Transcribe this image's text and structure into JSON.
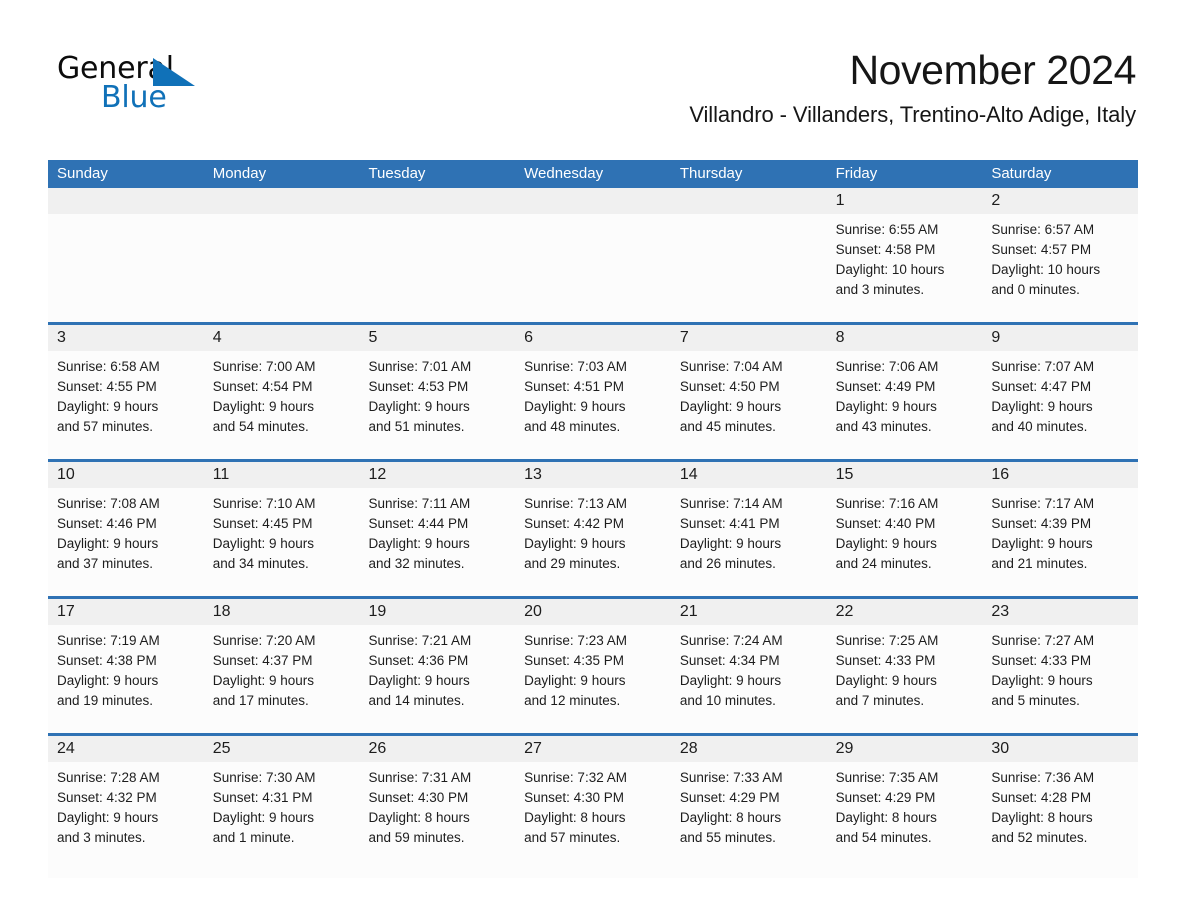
{
  "brand": {
    "name_part1": "General",
    "name_part2": "Blue",
    "logo_color": "#1071b8"
  },
  "header": {
    "month_title": "November 2024",
    "location": "Villandro - Villanders, Trentino-Alto Adige, Italy"
  },
  "theme": {
    "header_blue": "#2f72b4",
    "daynum_band": "#f0f0f0",
    "text": "#1d1d1d"
  },
  "weekdays": [
    "Sunday",
    "Monday",
    "Tuesday",
    "Wednesday",
    "Thursday",
    "Friday",
    "Saturday"
  ],
  "weeks": [
    {
      "days": [
        {
          "num": "",
          "sunrise": "",
          "sunset": "",
          "daylight1": "",
          "daylight2": ""
        },
        {
          "num": "",
          "sunrise": "",
          "sunset": "",
          "daylight1": "",
          "daylight2": ""
        },
        {
          "num": "",
          "sunrise": "",
          "sunset": "",
          "daylight1": "",
          "daylight2": ""
        },
        {
          "num": "",
          "sunrise": "",
          "sunset": "",
          "daylight1": "",
          "daylight2": ""
        },
        {
          "num": "",
          "sunrise": "",
          "sunset": "",
          "daylight1": "",
          "daylight2": ""
        },
        {
          "num": "1",
          "sunrise": "Sunrise: 6:55 AM",
          "sunset": "Sunset: 4:58 PM",
          "daylight1": "Daylight: 10 hours",
          "daylight2": "and 3 minutes."
        },
        {
          "num": "2",
          "sunrise": "Sunrise: 6:57 AM",
          "sunset": "Sunset: 4:57 PM",
          "daylight1": "Daylight: 10 hours",
          "daylight2": "and 0 minutes."
        }
      ]
    },
    {
      "days": [
        {
          "num": "3",
          "sunrise": "Sunrise: 6:58 AM",
          "sunset": "Sunset: 4:55 PM",
          "daylight1": "Daylight: 9 hours",
          "daylight2": "and 57 minutes."
        },
        {
          "num": "4",
          "sunrise": "Sunrise: 7:00 AM",
          "sunset": "Sunset: 4:54 PM",
          "daylight1": "Daylight: 9 hours",
          "daylight2": "and 54 minutes."
        },
        {
          "num": "5",
          "sunrise": "Sunrise: 7:01 AM",
          "sunset": "Sunset: 4:53 PM",
          "daylight1": "Daylight: 9 hours",
          "daylight2": "and 51 minutes."
        },
        {
          "num": "6",
          "sunrise": "Sunrise: 7:03 AM",
          "sunset": "Sunset: 4:51 PM",
          "daylight1": "Daylight: 9 hours",
          "daylight2": "and 48 minutes."
        },
        {
          "num": "7",
          "sunrise": "Sunrise: 7:04 AM",
          "sunset": "Sunset: 4:50 PM",
          "daylight1": "Daylight: 9 hours",
          "daylight2": "and 45 minutes."
        },
        {
          "num": "8",
          "sunrise": "Sunrise: 7:06 AM",
          "sunset": "Sunset: 4:49 PM",
          "daylight1": "Daylight: 9 hours",
          "daylight2": "and 43 minutes."
        },
        {
          "num": "9",
          "sunrise": "Sunrise: 7:07 AM",
          "sunset": "Sunset: 4:47 PM",
          "daylight1": "Daylight: 9 hours",
          "daylight2": "and 40 minutes."
        }
      ]
    },
    {
      "days": [
        {
          "num": "10",
          "sunrise": "Sunrise: 7:08 AM",
          "sunset": "Sunset: 4:46 PM",
          "daylight1": "Daylight: 9 hours",
          "daylight2": "and 37 minutes."
        },
        {
          "num": "11",
          "sunrise": "Sunrise: 7:10 AM",
          "sunset": "Sunset: 4:45 PM",
          "daylight1": "Daylight: 9 hours",
          "daylight2": "and 34 minutes."
        },
        {
          "num": "12",
          "sunrise": "Sunrise: 7:11 AM",
          "sunset": "Sunset: 4:44 PM",
          "daylight1": "Daylight: 9 hours",
          "daylight2": "and 32 minutes."
        },
        {
          "num": "13",
          "sunrise": "Sunrise: 7:13 AM",
          "sunset": "Sunset: 4:42 PM",
          "daylight1": "Daylight: 9 hours",
          "daylight2": "and 29 minutes."
        },
        {
          "num": "14",
          "sunrise": "Sunrise: 7:14 AM",
          "sunset": "Sunset: 4:41 PM",
          "daylight1": "Daylight: 9 hours",
          "daylight2": "and 26 minutes."
        },
        {
          "num": "15",
          "sunrise": "Sunrise: 7:16 AM",
          "sunset": "Sunset: 4:40 PM",
          "daylight1": "Daylight: 9 hours",
          "daylight2": "and 24 minutes."
        },
        {
          "num": "16",
          "sunrise": "Sunrise: 7:17 AM",
          "sunset": "Sunset: 4:39 PM",
          "daylight1": "Daylight: 9 hours",
          "daylight2": "and 21 minutes."
        }
      ]
    },
    {
      "days": [
        {
          "num": "17",
          "sunrise": "Sunrise: 7:19 AM",
          "sunset": "Sunset: 4:38 PM",
          "daylight1": "Daylight: 9 hours",
          "daylight2": "and 19 minutes."
        },
        {
          "num": "18",
          "sunrise": "Sunrise: 7:20 AM",
          "sunset": "Sunset: 4:37 PM",
          "daylight1": "Daylight: 9 hours",
          "daylight2": "and 17 minutes."
        },
        {
          "num": "19",
          "sunrise": "Sunrise: 7:21 AM",
          "sunset": "Sunset: 4:36 PM",
          "daylight1": "Daylight: 9 hours",
          "daylight2": "and 14 minutes."
        },
        {
          "num": "20",
          "sunrise": "Sunrise: 7:23 AM",
          "sunset": "Sunset: 4:35 PM",
          "daylight1": "Daylight: 9 hours",
          "daylight2": "and 12 minutes."
        },
        {
          "num": "21",
          "sunrise": "Sunrise: 7:24 AM",
          "sunset": "Sunset: 4:34 PM",
          "daylight1": "Daylight: 9 hours",
          "daylight2": "and 10 minutes."
        },
        {
          "num": "22",
          "sunrise": "Sunrise: 7:25 AM",
          "sunset": "Sunset: 4:33 PM",
          "daylight1": "Daylight: 9 hours",
          "daylight2": "and 7 minutes."
        },
        {
          "num": "23",
          "sunrise": "Sunrise: 7:27 AM",
          "sunset": "Sunset: 4:33 PM",
          "daylight1": "Daylight: 9 hours",
          "daylight2": "and 5 minutes."
        }
      ]
    },
    {
      "days": [
        {
          "num": "24",
          "sunrise": "Sunrise: 7:28 AM",
          "sunset": "Sunset: 4:32 PM",
          "daylight1": "Daylight: 9 hours",
          "daylight2": "and 3 minutes."
        },
        {
          "num": "25",
          "sunrise": "Sunrise: 7:30 AM",
          "sunset": "Sunset: 4:31 PM",
          "daylight1": "Daylight: 9 hours",
          "daylight2": "and 1 minute."
        },
        {
          "num": "26",
          "sunrise": "Sunrise: 7:31 AM",
          "sunset": "Sunset: 4:30 PM",
          "daylight1": "Daylight: 8 hours",
          "daylight2": "and 59 minutes."
        },
        {
          "num": "27",
          "sunrise": "Sunrise: 7:32 AM",
          "sunset": "Sunset: 4:30 PM",
          "daylight1": "Daylight: 8 hours",
          "daylight2": "and 57 minutes."
        },
        {
          "num": "28",
          "sunrise": "Sunrise: 7:33 AM",
          "sunset": "Sunset: 4:29 PM",
          "daylight1": "Daylight: 8 hours",
          "daylight2": "and 55 minutes."
        },
        {
          "num": "29",
          "sunrise": "Sunrise: 7:35 AM",
          "sunset": "Sunset: 4:29 PM",
          "daylight1": "Daylight: 8 hours",
          "daylight2": "and 54 minutes."
        },
        {
          "num": "30",
          "sunrise": "Sunrise: 7:36 AM",
          "sunset": "Sunset: 4:28 PM",
          "daylight1": "Daylight: 8 hours",
          "daylight2": "and 52 minutes."
        }
      ]
    }
  ]
}
